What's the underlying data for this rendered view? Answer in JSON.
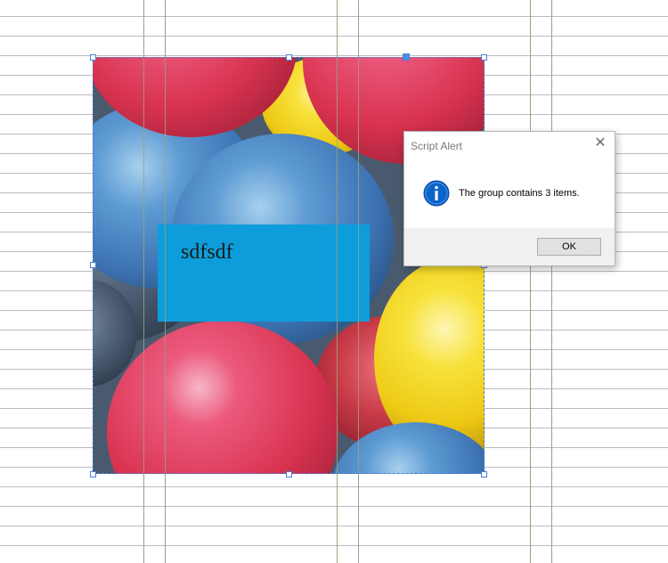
{
  "canvas": {
    "text_frame_text": "sdfsdf"
  },
  "dialog": {
    "title": "Script Alert",
    "close_glyph": "✕",
    "icon": "info-icon",
    "message": "The group contains 3 items.",
    "ok_label": "OK"
  },
  "colors": {
    "text_frame_fill": "#0d9ddb",
    "selection": "#4a7fd4",
    "dialog_footer": "#f0f0f0",
    "info_icon": "#0a63c9"
  }
}
